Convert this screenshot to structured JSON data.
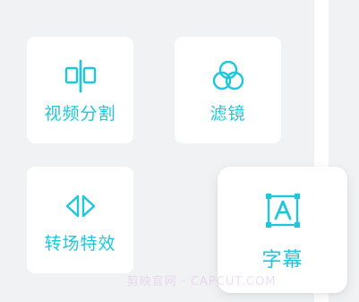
{
  "tools": {
    "split": {
      "label": "视频分割",
      "icon": "split-icon"
    },
    "filter": {
      "label": "滤镜",
      "icon": "filter-icon"
    },
    "reverse": {
      "label": "转场特效",
      "icon": "transition-icon"
    },
    "caption": {
      "label": "字幕",
      "icon": "caption-icon"
    }
  },
  "watermark": "剪映官网 · CAPCUT.COM",
  "colors": {
    "accent": "#1fc6dc",
    "background": "#f1f2f4",
    "tile": "#ffffff"
  }
}
